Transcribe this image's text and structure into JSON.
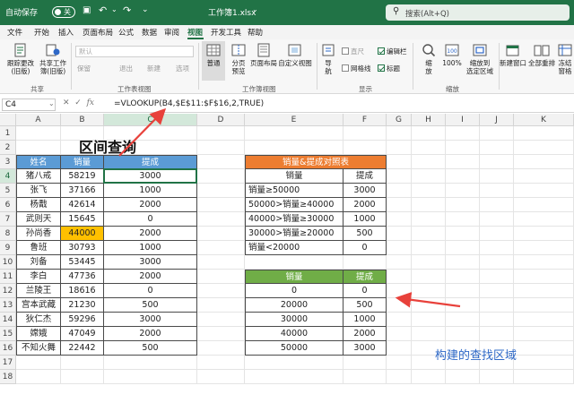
{
  "titlebar": {
    "autosave_label": "自动保存",
    "autosave_state": "关",
    "filename": "工作簿1.xlsx",
    "search_placeholder": "搜索(Alt+Q)"
  },
  "menu": [
    "文件",
    "开始",
    "插入",
    "页面布局",
    "公式",
    "数据",
    "审阅",
    "视图",
    "开发工具",
    "帮助"
  ],
  "menu_active": "视图",
  "ribbon": {
    "sheet_view": {
      "btn1": "跟踪更改\n(旧版)",
      "btn2": "共享工作\n簿(旧版)",
      "group": "共享",
      "dropdown": "默认",
      "keep": "保留",
      "exit": "退出",
      "new": "新建",
      "options": "选项",
      "group2": "工作表视图"
    },
    "workbook_views": {
      "normal": "普通",
      "page_break": "分页\n预览",
      "page_layout": "页面布局",
      "custom": "自定义视图",
      "group": "工作簿视图"
    },
    "show": {
      "nav": "导\n航",
      "ruler": "直尺",
      "gridlines": "网格线",
      "formula_bar": "编辑栏",
      "headings": "标题",
      "group": "显示"
    },
    "zoom": {
      "zoom": "缩\n放",
      "hundred": "100%",
      "to_selection": "缩放到\n选定区域",
      "group": "缩放"
    },
    "window": {
      "new_window": "新建窗口",
      "arrange_all": "全部重排",
      "freeze": "冻结窗格"
    }
  },
  "formula_bar": {
    "name_box": "C4",
    "formula": "=VLOOKUP(B4,$E$11:$F$16,2,TRUE)"
  },
  "columns": [
    "A",
    "B",
    "C",
    "D",
    "E",
    "F",
    "G",
    "H",
    "I",
    "J",
    "K"
  ],
  "rows": [
    "1",
    "2",
    "3",
    "4",
    "5",
    "6",
    "7",
    "8",
    "9",
    "10",
    "11",
    "12",
    "13",
    "14",
    "15",
    "16",
    "17",
    "18"
  ],
  "sheet_title": "区间查询",
  "main_table": {
    "headers": [
      "姓名",
      "销量",
      "提成"
    ],
    "rows": [
      [
        "猪八戒",
        "58219",
        "3000"
      ],
      [
        "张飞",
        "37166",
        "1000"
      ],
      [
        "杨戬",
        "42614",
        "2000"
      ],
      [
        "武则天",
        "15645",
        "0"
      ],
      [
        "孙尚香",
        "44000",
        "2000"
      ],
      [
        "鲁班",
        "30793",
        "1000"
      ],
      [
        "刘备",
        "53445",
        "3000"
      ],
      [
        "李白",
        "47736",
        "2000"
      ],
      [
        "兰陵王",
        "18616",
        "0"
      ],
      [
        "宫本武藏",
        "21230",
        "500"
      ],
      [
        "狄仁杰",
        "59296",
        "3000"
      ],
      [
        "嫦娥",
        "47049",
        "2000"
      ],
      [
        "不知火舞",
        "22442",
        "500"
      ]
    ]
  },
  "reference_table": {
    "title": "销量&提成对照表",
    "headers": [
      "销量",
      "提成"
    ],
    "rows": [
      [
        "销量≥50000",
        "3000"
      ],
      [
        "50000>销量≥40000",
        "2000"
      ],
      [
        "40000>销量≥30000",
        "1000"
      ],
      [
        "30000>销量≥20000",
        "500"
      ],
      [
        "销量<20000",
        "0"
      ]
    ]
  },
  "lookup_table": {
    "headers": [
      "销量",
      "提成"
    ],
    "rows": [
      [
        "0",
        "0"
      ],
      [
        "20000",
        "500"
      ],
      [
        "30000",
        "1000"
      ],
      [
        "40000",
        "2000"
      ],
      [
        "50000",
        "3000"
      ]
    ]
  },
  "annotation": "构建的查找区域",
  "colors": {
    "excel_green": "#217346",
    "header_blue": "#5b9bd5",
    "header_orange": "#ed7d31",
    "header_green": "#70ad47",
    "highlight_yellow": "#ffc000",
    "arrow_red": "#e8413b",
    "annotation_blue": "#2e68c7"
  }
}
